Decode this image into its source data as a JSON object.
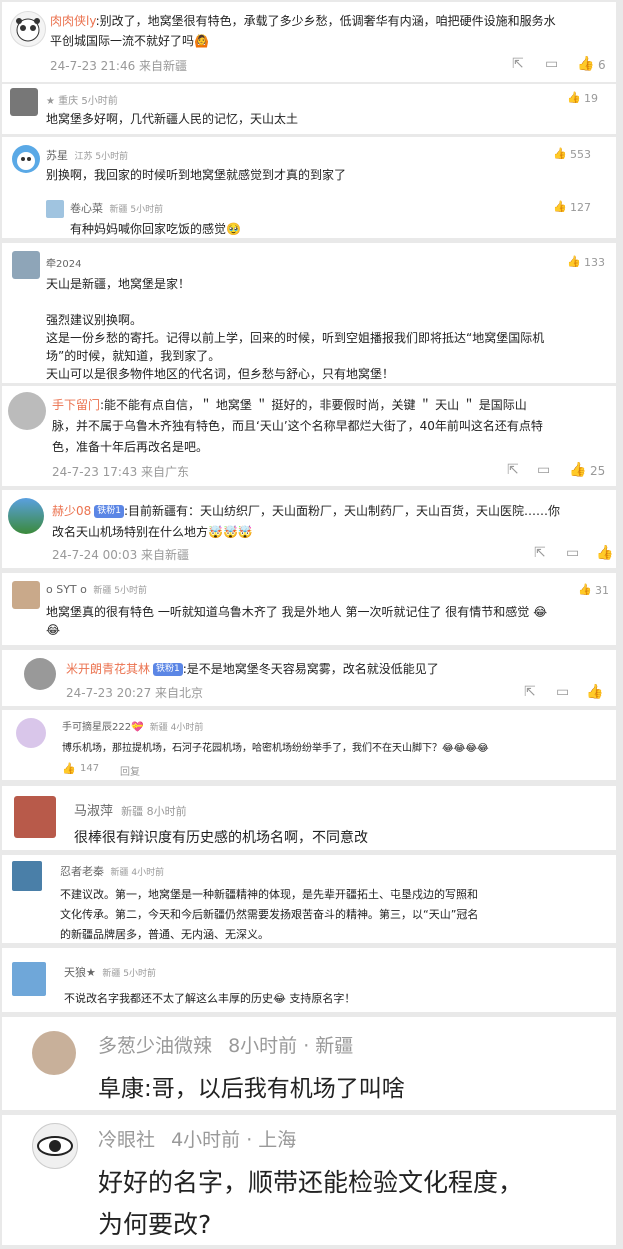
{
  "comments": [
    {
      "name": "肉肉侠ly",
      "text": ":别改了，地窝堡很有特色，承载了多少乡愁，低调奢华有内涵，咱把硬件设施和服务水平创城国际一流不就好了吗",
      "text_l1": ":别改了，地窝堡很有特色，承载了多少乡愁，低调奢华有内涵，咱把硬件设施和服务水",
      "text_l2": "平创城国际一流不就好了吗🙆",
      "time": "24-7-23 21:46 来自新疆",
      "likes": "6"
    },
    {
      "name": "重庆 5小时前",
      "text": "地窝堡多好啊，几代新疆人民的记忆，天山太土",
      "likes": "19"
    },
    {
      "name": "苏星",
      "location_time": "江苏  5小时前",
      "text": "别换啊，我回家的时候听到地窝堡就感觉到才真的到家了",
      "likes": "553",
      "reply": {
        "name": "卷心菜",
        "location_time": "新疆  5小时前",
        "text": "有种妈妈喊你回家吃饭的感觉🥹",
        "likes": "127"
      }
    },
    {
      "name": "牵2024",
      "likes": "133",
      "line1": "天山是新疆，地窝堡是家！",
      "line2": "强烈建议别换啊。",
      "line3": "这是一份乡愁的寄托。记得以前上学，回来的时候，听到空姐播报我们即将抵达“地窝堡国际机",
      "line4": "场”的时候，就知道，我到家了。",
      "line5": "天山可以是很多物件地区的代名词，但乡愁与舒心，只有地窝堡！"
    },
    {
      "name": "手下留门",
      "text_l1": ":能不能有点自信，＂ 地窝堡 ＂ 挺好的，非要假时尚，关键 ＂ 天山 ＂ 是国际山",
      "text_l2": "脉，并不属于乌鲁木齐独有特色，而且‘天山’这个名称早都烂大街了，40年前叫这名还有点特",
      "text_l3": "色，准备十年后再改名是吧。",
      "time": "24-7-23 17:43 来自广东",
      "likes": "25"
    },
    {
      "name": "赫少08",
      "badge": "铁粉1",
      "text_l1": ":目前新疆有：天山纺织厂，天山面粉厂，天山制药厂，天山百货，天山医院……你",
      "text_l2": "改名天山机场特别在什么地方🤯🤯🤯",
      "time": "24-7-24 00:03 来自新疆"
    },
    {
      "name": "o SYT o",
      "location_time": "新疆  5小时前",
      "text_l1": "地窝堡真的很有特色 一听就知道乌鲁木齐了 我是外地人 第一次听就记住了 很有情节和感觉 😂",
      "text_l2": "😂",
      "likes": "31"
    },
    {
      "name": "米开朗青花其林",
      "badge": "铁粉1",
      "text": ":是不是地窝堡冬天容易窝雾，改名就没低能见了",
      "time": "24-7-23 20:27 来自北京"
    },
    {
      "name": "手可摘星辰222",
      "badge": "💝",
      "location_time": "新疆  4小时前",
      "text": "博乐机场，那拉提机场，石河子花园机场，哈密机场纷纷举手了，我们不在天山脚下？😂😂😂😂",
      "likes": "147",
      "reply_label": "回复"
    },
    {
      "name": "马淑萍",
      "location_time": "新疆  8小时前",
      "text": "很棒很有辩识度有历史感的机场名啊，不同意改"
    },
    {
      "name": "忍者老秦",
      "location_time": "新疆  4小时前",
      "text_l1": "不建议改。第一，地窝堡是一种新疆精神的体现，是先辈开疆拓土、屯垦戍边的写照和",
      "text_l2": "文化传承。第二，今天和今后新疆仍然需要发扬艰苦奋斗的精神。第三，以“天山”冠名",
      "text_l3": "的新疆品牌居多，普通、无内涵、无深义。"
    },
    {
      "name": "天狼★",
      "location_time": "新疆  5小时前",
      "text": "不说改名字我都还不太了解这么丰厚的历史😂 支持原名字！"
    },
    {
      "name": "多葱少油微辣",
      "meta": "8小时前 · 新疆",
      "text": "阜康:哥，以后我有机场了叫啥"
    },
    {
      "name": "冷眼社",
      "meta": "4小时前 · 上海",
      "text_l1": "好好的名字，顺带还能检验文化程度，",
      "text_l2": "为何要改?"
    }
  ],
  "colors": {
    "orange": "#eb7350",
    "blue_badge": "#5b86e5",
    "gray": "#999999"
  },
  "icons": [
    "share-icon",
    "comment-icon",
    "like-icon"
  ]
}
